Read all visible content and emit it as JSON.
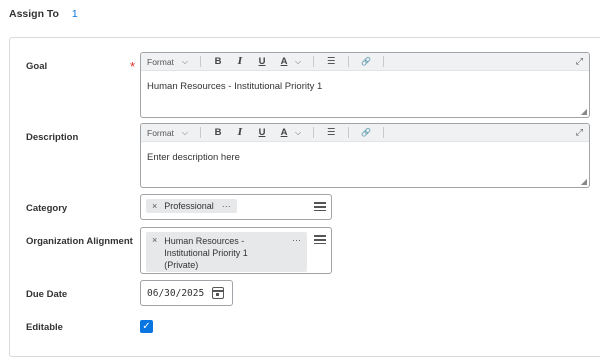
{
  "assign_to": {
    "label": "Assign To",
    "count": "1"
  },
  "fields": {
    "goal": {
      "label": "Goal",
      "required_mark": "*",
      "value": "Human Resources - Institutional Priority 1"
    },
    "description": {
      "label": "Description",
      "placeholder": "Enter description here"
    },
    "category": {
      "label": "Category",
      "selected": "Professional"
    },
    "organization_alignment": {
      "label": "Organization Alignment",
      "selected_lines": [
        "Human Resources -",
        "Institutional Priority 1",
        "(Private)"
      ]
    },
    "due_date": {
      "label": "Due Date",
      "value": "06/30/2025"
    },
    "editable": {
      "label": "Editable",
      "checked": true
    }
  },
  "toolbar": {
    "format_label": "Format",
    "chevron": "⌵",
    "bold": "B",
    "italic": "I",
    "underline": "U",
    "font_color": "A",
    "list": "☰",
    "link": "🔗",
    "expand": "⤢"
  },
  "pill": {
    "remove": "×",
    "more": "···"
  },
  "icons": {
    "expand": "expand-icon",
    "list": "bullet-list-icon",
    "link": "link-icon",
    "calendar": "calendar-icon",
    "check": "checkmark-icon"
  },
  "colors": {
    "accent": "#0875e1",
    "required": "#de2e21"
  }
}
